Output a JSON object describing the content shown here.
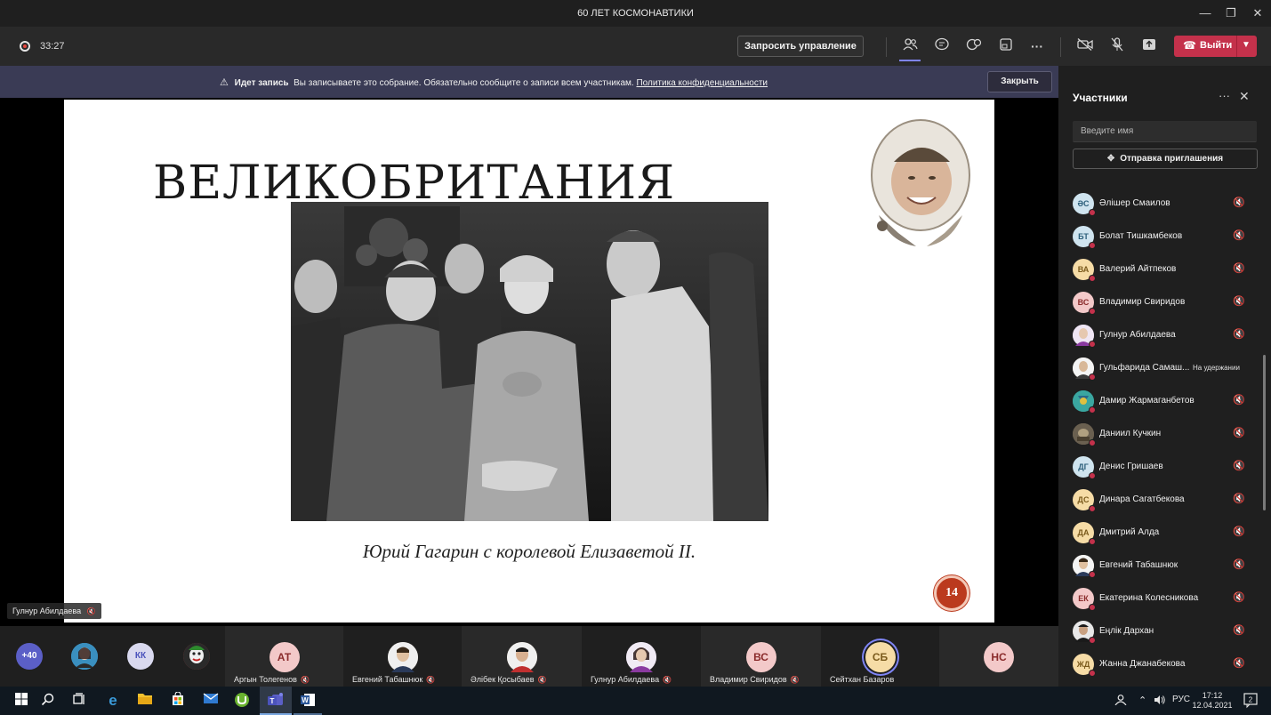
{
  "window": {
    "title": "60 ЛЕТ КОСМОНАВТИКИ",
    "controls": [
      "minimize-icon",
      "maximize-icon",
      "close-icon"
    ]
  },
  "toolbar": {
    "timer": "33:27",
    "request_control": "Запросить управление",
    "leave": "Выйти",
    "icons": [
      "people-icon",
      "chat-icon",
      "reactions-icon",
      "rooms-icon",
      "more-icon",
      "camera-off-icon",
      "mic-off-icon",
      "share-icon"
    ]
  },
  "banner": {
    "title": "Идет запись",
    "message": "Вы записываете это собрание. Обязательно сообщите о записи всем участникам.",
    "link": "Политика конфиденциальности",
    "close": "Закрыть"
  },
  "slide": {
    "title": "ВЕЛИКОБРИТАНИЯ",
    "caption": "Юрий Гагарин с королевой Елизаветой II.",
    "page_number": "14"
  },
  "presenter": {
    "name": "Гулнур Абилдаева"
  },
  "strip": {
    "overflow": "+40",
    "mini": [
      {
        "initials": "",
        "color": "#3a8fbf"
      },
      {
        "initials": "КК",
        "color": "#d9d9ef"
      },
      {
        "initials": "",
        "color": "#b04040"
      }
    ],
    "tiles": [
      {
        "initials": "АТ",
        "name": "Аргын Толегенов",
        "color": "#f3c9c9",
        "photo": false
      },
      {
        "initials": "",
        "name": "Евгений Табашнюк",
        "color": "#e8d4c0",
        "photo": true
      },
      {
        "initials": "",
        "name": "Әлібек Қосыбаев",
        "color": "#d9b89a",
        "photo": true
      },
      {
        "initials": "",
        "name": "Гулнур Абилдаева",
        "color": "#c9b3d6",
        "photo": true
      },
      {
        "initials": "ВС",
        "name": "Владимир Свиридов",
        "color": "#f3c9c9",
        "photo": false
      },
      {
        "initials": "СБ",
        "name": "Сейтхан Базаров",
        "color": "#f6dca6",
        "photo": false
      },
      {
        "initials": "НС",
        "name": "",
        "color": "#f3c9c9",
        "photo": false
      }
    ]
  },
  "panel": {
    "title": "Участники",
    "search_placeholder": "Введите имя",
    "invite": "Отправка приглашения",
    "participants": [
      {
        "initials": "ӘС",
        "name": "Әлішер Смаилов",
        "color": "#cfe4ef",
        "fg": "#2c5f7a",
        "status": ""
      },
      {
        "initials": "БТ",
        "name": "Болат Тишкамбеков",
        "color": "#cfe4ef",
        "fg": "#2c5f7a",
        "status": ""
      },
      {
        "initials": "ВА",
        "name": "Валерий Айтпеков",
        "color": "#f6dca6",
        "fg": "#7a5a1c",
        "status": ""
      },
      {
        "initials": "ВС",
        "name": "Владимир Свиридов",
        "color": "#f3c9c9",
        "fg": "#8a2b2b",
        "status": ""
      },
      {
        "initials": "",
        "name": "Гулнур Абилдаева",
        "color": "#b89ccc",
        "fg": "#fff",
        "status": ""
      },
      {
        "initials": "",
        "name": "Гульфарида Самаш...",
        "color": "#c8b49a",
        "fg": "#fff",
        "status": "На удержании"
      },
      {
        "initials": "",
        "name": "Дамир Жармаганбетов",
        "color": "#3aa6a0",
        "fg": "#fff",
        "status": ""
      },
      {
        "initials": "",
        "name": "Даниил Кучкин",
        "color": "#8a7a60",
        "fg": "#fff",
        "status": ""
      },
      {
        "initials": "ДГ",
        "name": "Денис Гришаев",
        "color": "#cfe4ef",
        "fg": "#2c5f7a",
        "status": ""
      },
      {
        "initials": "ДС",
        "name": "Динара Сагатбекова",
        "color": "#f6dca6",
        "fg": "#7a5a1c",
        "status": ""
      },
      {
        "initials": "ДА",
        "name": "Дмитрий Алда",
        "color": "#f6dca6",
        "fg": "#7a5a1c",
        "status": ""
      },
      {
        "initials": "",
        "name": "Евгений Табашнюк",
        "color": "#e8d4c0",
        "fg": "#fff",
        "status": ""
      },
      {
        "initials": "ЕК",
        "name": "Екатерина Колесникова",
        "color": "#f3c9c9",
        "fg": "#8a2b2b",
        "status": ""
      },
      {
        "initials": "",
        "name": "Еңлік Дархан",
        "color": "#6a5a4a",
        "fg": "#fff",
        "status": ""
      },
      {
        "initials": "ЖД",
        "name": "Жанна Джанабекова",
        "color": "#f6dca6",
        "fg": "#7a5a1c",
        "status": ""
      }
    ]
  },
  "taskbar": {
    "icons": [
      "windows-start-icon",
      "search-icon",
      "task-view-icon",
      "edge-icon",
      "file-explorer-icon",
      "store-icon",
      "mail-icon",
      "utorrent-icon",
      "teams-icon",
      "word-icon"
    ],
    "language": "РУС",
    "time": "17:12",
    "date": "12.04.2021",
    "notifications": "2"
  }
}
